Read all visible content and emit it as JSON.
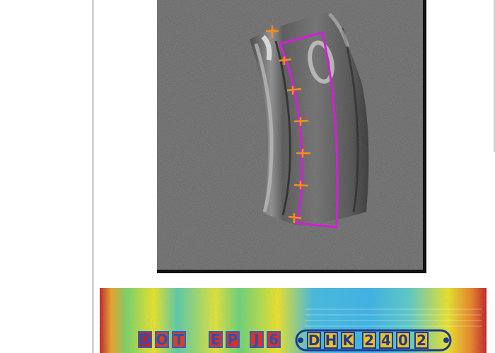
{
  "viewer": {
    "tire_image": {
      "label": "tire-sidewall-scan"
    },
    "heatmap": {
      "label": "unwrapped-sidewall-heatmap",
      "dot_text": [
        "D",
        "O",
        "T"
      ],
      "plant_text": [
        "E",
        "P",
        "J",
        "6"
      ],
      "code_text": [
        "D",
        "H",
        "K",
        "2",
        "4",
        "0",
        "2"
      ]
    },
    "colors": {
      "roi_outline": "#d21fd6",
      "tick_marks": "#ff8c1a",
      "scan_background": "#5a5a5a",
      "heat_hot": "#c81e1e",
      "heat_warm": "#f0e020",
      "heat_cool": "#20b0e0"
    }
  }
}
